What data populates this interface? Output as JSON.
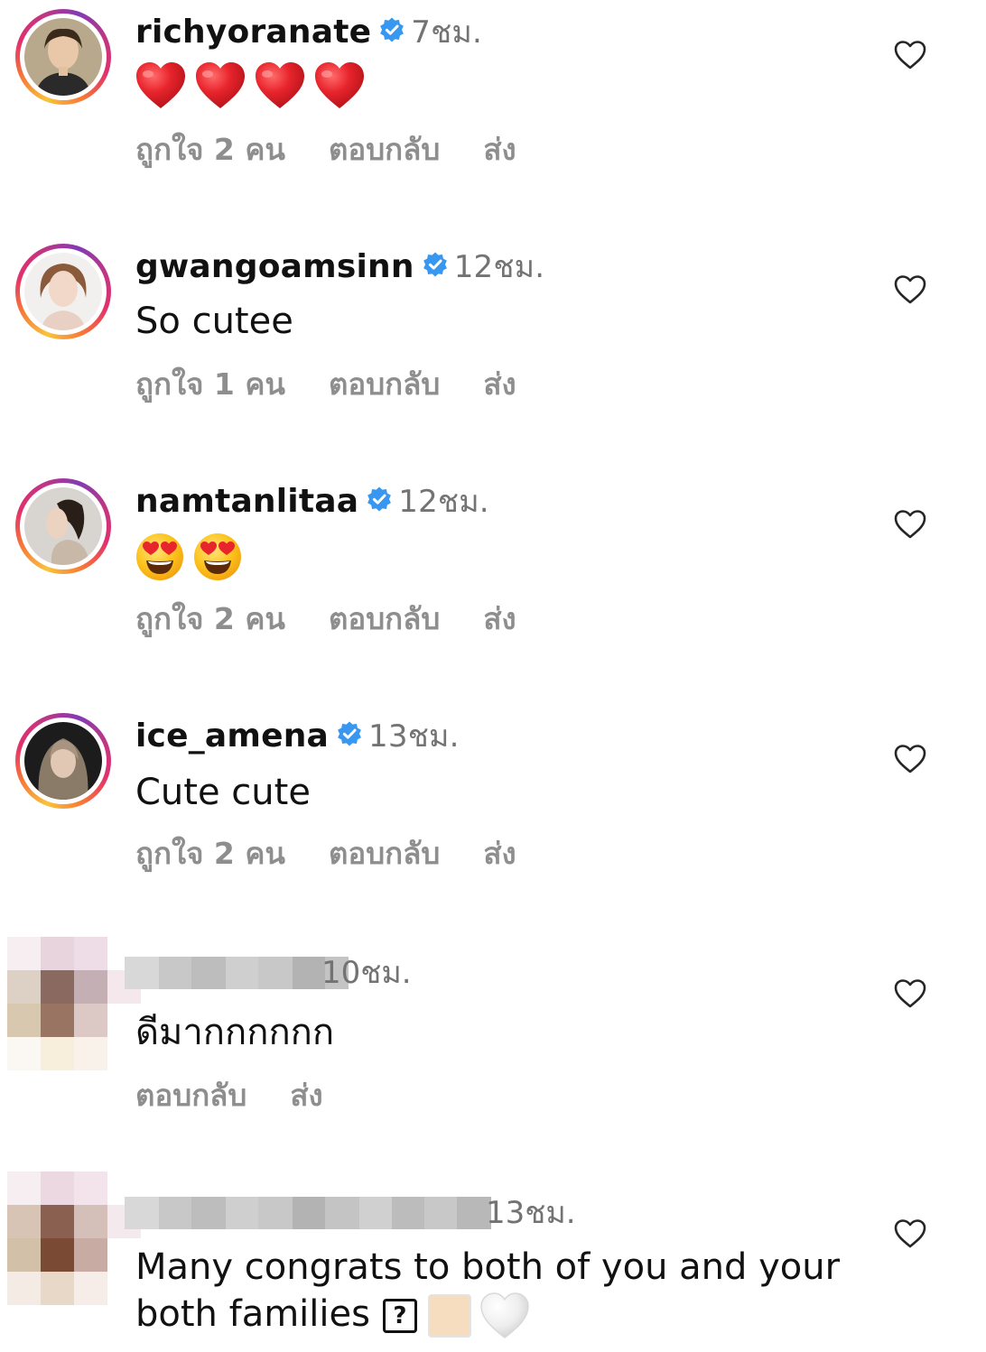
{
  "comments": [
    {
      "username": "richyoranate",
      "time": "7ชม.",
      "likes": "ถูกใจ 2 คน",
      "reply": "ตอบกลับ",
      "send": "ส่ง"
    },
    {
      "username": "gwangoamsinn",
      "time": "12ชม.",
      "text": "So cutee",
      "likes": "ถูกใจ 1 คน",
      "reply": "ตอบกลับ",
      "send": "ส่ง"
    },
    {
      "username": "namtanlitaa",
      "time": "12ชม.",
      "likes": "ถูกใจ 2 คน",
      "reply": "ตอบกลับ",
      "send": "ส่ง"
    },
    {
      "username": "ice_amena",
      "time": "13ชม.",
      "text": "Cute cute",
      "likes": "ถูกใจ 2 คน",
      "reply": "ตอบกลับ",
      "send": "ส่ง"
    },
    {
      "time": "10ชม.",
      "text": "ดีมากกกกกก",
      "reply": "ตอบกลับ",
      "send": "ส่ง"
    },
    {
      "time": "13ชม.",
      "text_line1": "Many congrats to both of you and your",
      "text_line2": "both families",
      "unknown_glyph": "?"
    }
  ],
  "colors": {
    "verified": "#3897f0",
    "secondary_text": "#8e8e8e",
    "heart_red": "#e0242b"
  },
  "icons": [
    "heart-outline-icon",
    "verified-badge-icon",
    "red-heart-emoji",
    "heart-eyes-emoji",
    "white-heart-emoji"
  ]
}
